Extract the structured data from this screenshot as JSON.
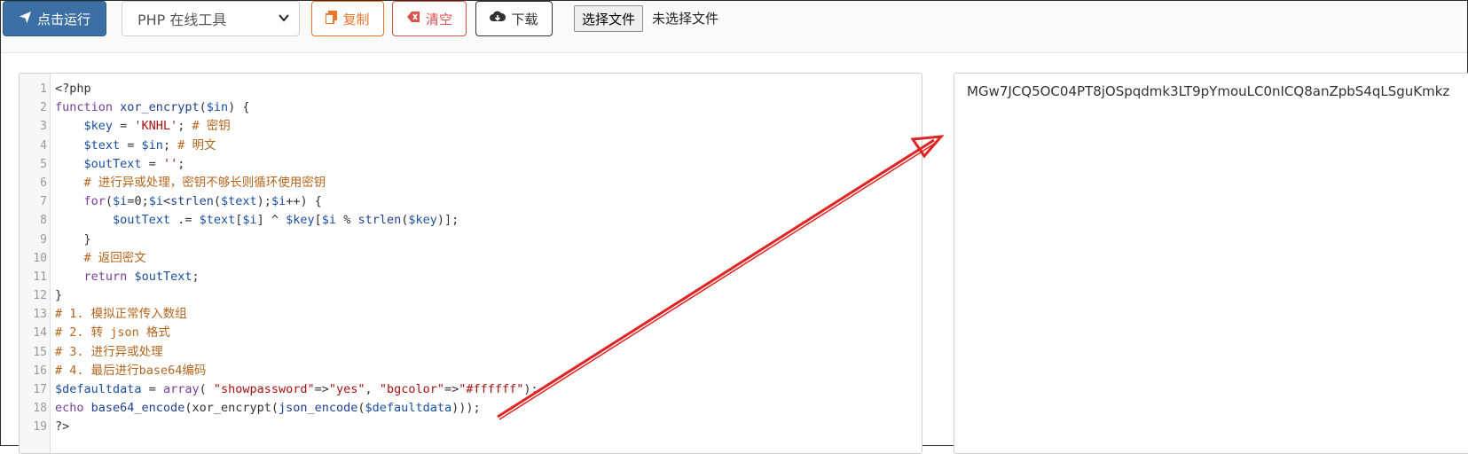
{
  "toolbar": {
    "run_label": "点击运行",
    "tool_select_value": "PHP 在线工具",
    "copy_label": "复制",
    "clear_label": "清空",
    "download_label": "下载",
    "file_button_label": "选择文件",
    "file_status": "未选择文件"
  },
  "editor": {
    "line_numbers": [
      "1",
      "2",
      "3",
      "4",
      "5",
      "6",
      "7",
      "8",
      "9",
      "10",
      "11",
      "12",
      "13",
      "14",
      "15",
      "16",
      "17",
      "18",
      "19"
    ]
  },
  "output": {
    "text": "MGw7JCQ5OC04PT8jOSpqdmk3LT9pYmouLC0nICQ8anZpbS4qLSguKmkz"
  },
  "colors": {
    "run_button": "#3c6fa3",
    "copy_button": "#e9762b",
    "clear_button": "#d9534f",
    "annotation_arrow": "#e02424"
  },
  "icons": {
    "run": "paper-plane-icon",
    "select": "chevron-down-icon",
    "copy": "copy-icon",
    "clear": "eraser-icon",
    "download": "cloud-download-icon"
  }
}
